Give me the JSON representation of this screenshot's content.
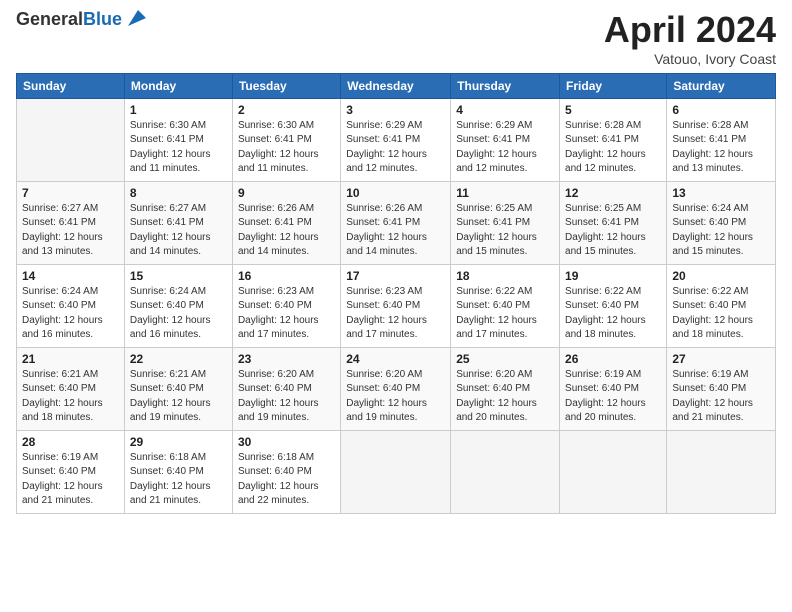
{
  "header": {
    "logo_general": "General",
    "logo_blue": "Blue",
    "title": "April 2024",
    "subtitle": "Vatouo, Ivory Coast"
  },
  "days_of_week": [
    "Sunday",
    "Monday",
    "Tuesday",
    "Wednesday",
    "Thursday",
    "Friday",
    "Saturday"
  ],
  "weeks": [
    [
      {
        "num": "",
        "detail": ""
      },
      {
        "num": "1",
        "detail": "Sunrise: 6:30 AM\nSunset: 6:41 PM\nDaylight: 12 hours\nand 11 minutes."
      },
      {
        "num": "2",
        "detail": "Sunrise: 6:30 AM\nSunset: 6:41 PM\nDaylight: 12 hours\nand 11 minutes."
      },
      {
        "num": "3",
        "detail": "Sunrise: 6:29 AM\nSunset: 6:41 PM\nDaylight: 12 hours\nand 12 minutes."
      },
      {
        "num": "4",
        "detail": "Sunrise: 6:29 AM\nSunset: 6:41 PM\nDaylight: 12 hours\nand 12 minutes."
      },
      {
        "num": "5",
        "detail": "Sunrise: 6:28 AM\nSunset: 6:41 PM\nDaylight: 12 hours\nand 12 minutes."
      },
      {
        "num": "6",
        "detail": "Sunrise: 6:28 AM\nSunset: 6:41 PM\nDaylight: 12 hours\nand 13 minutes."
      }
    ],
    [
      {
        "num": "7",
        "detail": "Sunrise: 6:27 AM\nSunset: 6:41 PM\nDaylight: 12 hours\nand 13 minutes."
      },
      {
        "num": "8",
        "detail": "Sunrise: 6:27 AM\nSunset: 6:41 PM\nDaylight: 12 hours\nand 14 minutes."
      },
      {
        "num": "9",
        "detail": "Sunrise: 6:26 AM\nSunset: 6:41 PM\nDaylight: 12 hours\nand 14 minutes."
      },
      {
        "num": "10",
        "detail": "Sunrise: 6:26 AM\nSunset: 6:41 PM\nDaylight: 12 hours\nand 14 minutes."
      },
      {
        "num": "11",
        "detail": "Sunrise: 6:25 AM\nSunset: 6:41 PM\nDaylight: 12 hours\nand 15 minutes."
      },
      {
        "num": "12",
        "detail": "Sunrise: 6:25 AM\nSunset: 6:41 PM\nDaylight: 12 hours\nand 15 minutes."
      },
      {
        "num": "13",
        "detail": "Sunrise: 6:24 AM\nSunset: 6:40 PM\nDaylight: 12 hours\nand 15 minutes."
      }
    ],
    [
      {
        "num": "14",
        "detail": "Sunrise: 6:24 AM\nSunset: 6:40 PM\nDaylight: 12 hours\nand 16 minutes."
      },
      {
        "num": "15",
        "detail": "Sunrise: 6:24 AM\nSunset: 6:40 PM\nDaylight: 12 hours\nand 16 minutes."
      },
      {
        "num": "16",
        "detail": "Sunrise: 6:23 AM\nSunset: 6:40 PM\nDaylight: 12 hours\nand 17 minutes."
      },
      {
        "num": "17",
        "detail": "Sunrise: 6:23 AM\nSunset: 6:40 PM\nDaylight: 12 hours\nand 17 minutes."
      },
      {
        "num": "18",
        "detail": "Sunrise: 6:22 AM\nSunset: 6:40 PM\nDaylight: 12 hours\nand 17 minutes."
      },
      {
        "num": "19",
        "detail": "Sunrise: 6:22 AM\nSunset: 6:40 PM\nDaylight: 12 hours\nand 18 minutes."
      },
      {
        "num": "20",
        "detail": "Sunrise: 6:22 AM\nSunset: 6:40 PM\nDaylight: 12 hours\nand 18 minutes."
      }
    ],
    [
      {
        "num": "21",
        "detail": "Sunrise: 6:21 AM\nSunset: 6:40 PM\nDaylight: 12 hours\nand 18 minutes."
      },
      {
        "num": "22",
        "detail": "Sunrise: 6:21 AM\nSunset: 6:40 PM\nDaylight: 12 hours\nand 19 minutes."
      },
      {
        "num": "23",
        "detail": "Sunrise: 6:20 AM\nSunset: 6:40 PM\nDaylight: 12 hours\nand 19 minutes."
      },
      {
        "num": "24",
        "detail": "Sunrise: 6:20 AM\nSunset: 6:40 PM\nDaylight: 12 hours\nand 19 minutes."
      },
      {
        "num": "25",
        "detail": "Sunrise: 6:20 AM\nSunset: 6:40 PM\nDaylight: 12 hours\nand 20 minutes."
      },
      {
        "num": "26",
        "detail": "Sunrise: 6:19 AM\nSunset: 6:40 PM\nDaylight: 12 hours\nand 20 minutes."
      },
      {
        "num": "27",
        "detail": "Sunrise: 6:19 AM\nSunset: 6:40 PM\nDaylight: 12 hours\nand 21 minutes."
      }
    ],
    [
      {
        "num": "28",
        "detail": "Sunrise: 6:19 AM\nSunset: 6:40 PM\nDaylight: 12 hours\nand 21 minutes."
      },
      {
        "num": "29",
        "detail": "Sunrise: 6:18 AM\nSunset: 6:40 PM\nDaylight: 12 hours\nand 21 minutes."
      },
      {
        "num": "30",
        "detail": "Sunrise: 6:18 AM\nSunset: 6:40 PM\nDaylight: 12 hours\nand 22 minutes."
      },
      {
        "num": "",
        "detail": ""
      },
      {
        "num": "",
        "detail": ""
      },
      {
        "num": "",
        "detail": ""
      },
      {
        "num": "",
        "detail": ""
      }
    ]
  ]
}
